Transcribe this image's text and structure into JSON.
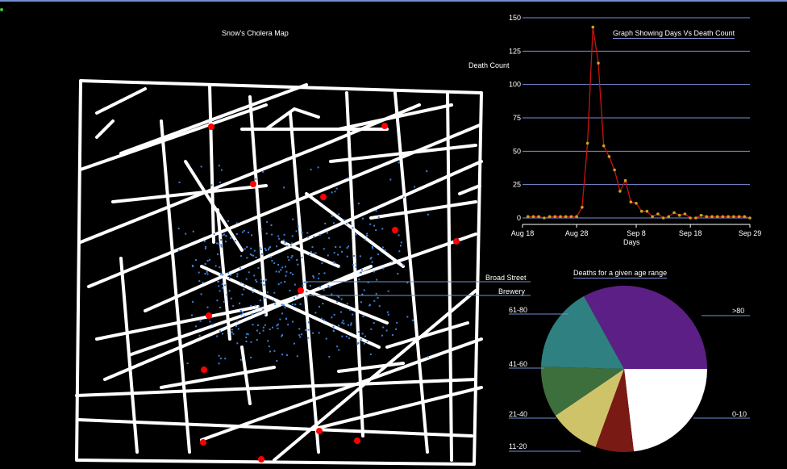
{
  "map": {
    "title": "Snow's Cholera Map",
    "annotations": [
      {
        "label": "Broad Street"
      },
      {
        "label": "Brewery"
      }
    ],
    "colors": {
      "streets": "#ffffff",
      "pumps": "#ff0000",
      "deaths": "#3f7fd8"
    }
  },
  "chart_data": [
    {
      "type": "line",
      "title": "Graph Showing Days Vs Death Count",
      "xlabel": "Days",
      "ylabel": "Death Count",
      "xticks": [
        "Aug 18",
        "Aug 28",
        "Sep 8",
        "Sep 18",
        "Sep 29"
      ],
      "yticks": [
        0,
        25,
        50,
        75,
        100,
        125,
        150
      ],
      "ylim": [
        0,
        150
      ],
      "grid": true,
      "series": [
        {
          "x": [
            "1854-08-19",
            "1854-08-20",
            "1854-08-21",
            "1854-08-22",
            "1854-08-23",
            "1854-08-24",
            "1854-08-25",
            "1854-08-26",
            "1854-08-27",
            "1854-08-28",
            "1854-08-29",
            "1854-08-30",
            "1854-08-31",
            "1854-09-01",
            "1854-09-02",
            "1854-09-03",
            "1854-09-04",
            "1854-09-05",
            "1854-09-06",
            "1854-09-07",
            "1854-09-08",
            "1854-09-09",
            "1854-09-10",
            "1854-09-11",
            "1854-09-12",
            "1854-09-13",
            "1854-09-14",
            "1854-09-15",
            "1854-09-16",
            "1854-09-17",
            "1854-09-18",
            "1854-09-19",
            "1854-09-20",
            "1854-09-21",
            "1854-09-22",
            "1854-09-23",
            "1854-09-24",
            "1854-09-25",
            "1854-09-26",
            "1854-09-27",
            "1854-09-28",
            "1854-09-29"
          ],
          "values": [
            1,
            1,
            1,
            0,
            1,
            1,
            1,
            1,
            1,
            1,
            8,
            56,
            143,
            116,
            54,
            46,
            36,
            20,
            28,
            12,
            11,
            5,
            5,
            1,
            3,
            0,
            1,
            4,
            2,
            3,
            0,
            0,
            2,
            1,
            1,
            1,
            1,
            1,
            1,
            1,
            1,
            0
          ],
          "color": "#cc1111",
          "marker_color": "#c8a418"
        }
      ]
    },
    {
      "type": "pie",
      "title": "Deaths for a given age range",
      "slices": [
        {
          "label": ">80",
          "value": 40,
          "color": "#5c1f86"
        },
        {
          "label": "0-10",
          "value": 28,
          "color": "#ffffff"
        },
        {
          "label": "11-20",
          "value": 9,
          "color": "#7a1a14"
        },
        {
          "label": "21-40",
          "value": 12,
          "color": "#cfc36a"
        },
        {
          "label": "41-60",
          "value": 12,
          "color": "#3d6f3d"
        },
        {
          "label": "61-80",
          "value": 20,
          "color": "#2f8080"
        }
      ]
    }
  ]
}
